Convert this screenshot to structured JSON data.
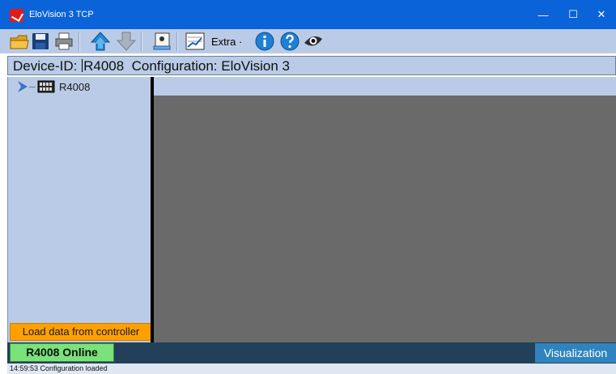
{
  "window": {
    "title": "EloVision 3 TCP",
    "controls": {
      "minimize": "—",
      "maximize": "☐",
      "close": "✕"
    }
  },
  "toolbar": {
    "extra_label": "Extra ·",
    "icons": [
      "open-folder-icon",
      "save-icon",
      "print-icon",
      "upload-icon",
      "download-icon",
      "device-config-icon",
      "chart-icon",
      "info-icon",
      "help-icon",
      "eye-icon"
    ]
  },
  "device_header": {
    "label_prefix": "Device-ID:",
    "device_id": "R4008",
    "config_label": "Configuration:",
    "config_name": "EloVision 3"
  },
  "tree": {
    "items": [
      {
        "label": "R4008"
      }
    ]
  },
  "left_panel": {
    "load_button": "Load data from controller"
  },
  "status": {
    "online": "R4008 Online",
    "visualization": "Visualization",
    "log": "14:59:53  Configuration loaded"
  },
  "colors": {
    "titlebar": "#0a63d8",
    "panel": "#b9cbe6",
    "workspace": "#6a6a6a",
    "load_button": "#ffa000",
    "online": "#7ae27a",
    "status_row": "#23405a",
    "visualization": "#2f84bf"
  }
}
